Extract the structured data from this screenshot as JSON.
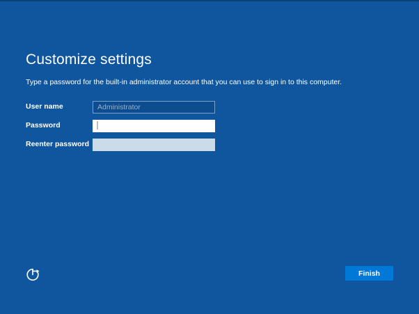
{
  "page": {
    "title": "Customize settings",
    "subtitle": "Type a password for the built-in administrator account that you can use to sign in to this computer."
  },
  "form": {
    "fields": [
      {
        "label": "User name",
        "value": "",
        "placeholder": "Administrator",
        "state": "readonly"
      },
      {
        "label": "Password",
        "value": "",
        "placeholder": "",
        "state": "focused-with-cursor"
      },
      {
        "label": "Reenter password",
        "value": "",
        "placeholder": "",
        "state": "empty"
      }
    ]
  },
  "footer": {
    "finish_label": "Finish",
    "icons": [
      "ease-of-access-icon"
    ]
  },
  "colors": {
    "background": "#10569E",
    "top_edge": "#0B4173",
    "finish_button": "#0078D7",
    "username_field_bg": "#0D4D8F",
    "username_field_border": "#7EA1C6",
    "username_placeholder_text": "#98AFCB",
    "password_field_bg": "#FFFFFF",
    "reenter_field_bg": "#CBDBEA",
    "text": "#FFFFFF"
  }
}
